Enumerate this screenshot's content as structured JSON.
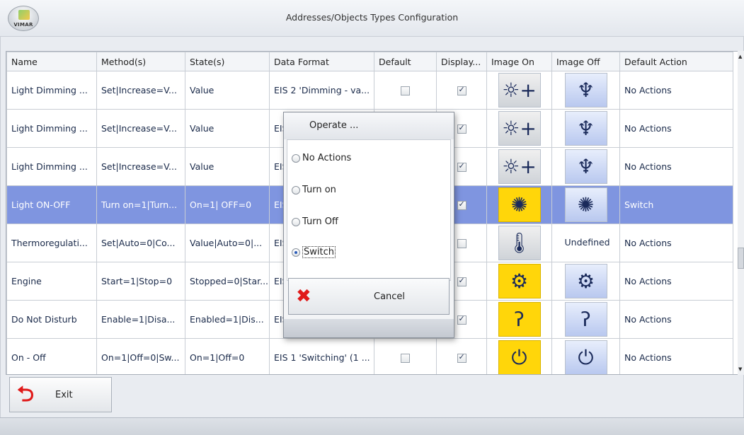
{
  "window": {
    "title": "Addresses/Objects Types Configuration",
    "logo_text": "VIMAR"
  },
  "columns": [
    "Name",
    "Method(s)",
    "State(s)",
    "Data Format",
    "Default",
    "Display...",
    "Image On",
    "Image Off",
    "Default Action"
  ],
  "rows": [
    {
      "name": "Light Dimming ...",
      "methods": "Set|Increase=V...",
      "states": "Value",
      "data_format": "EIS 2 'Dimming - va...",
      "default": false,
      "display": true,
      "image_on": "dimmer-plus-icon",
      "image_off": "dimmer-off-icon",
      "default_action": "No Actions"
    },
    {
      "name": "Light Dimming ...",
      "methods": "Set|Increase=V...",
      "states": "Value",
      "data_format": "EIS",
      "default": false,
      "display": true,
      "image_on": "dimmer-plus-icon",
      "image_off": "dimmer-off-icon",
      "default_action": "No Actions"
    },
    {
      "name": "Light Dimming ...",
      "methods": "Set|Increase=V...",
      "states": "Value",
      "data_format": "EIS",
      "default": false,
      "display": true,
      "image_on": "dimmer-plus-icon",
      "image_off": "dimmer-off-icon",
      "default_action": "No Actions"
    },
    {
      "name": "Light ON-OFF",
      "methods": "Turn on=1|Turn...",
      "states": "On=1| OFF=0",
      "data_format": "EIS",
      "default": false,
      "display": true,
      "image_on": "light-on-icon",
      "image_off": "light-off-icon",
      "default_action": "Switch",
      "selected": true
    },
    {
      "name": "Thermoregulati...",
      "methods": "Set|Auto=0|Co...",
      "states": "Value|Auto=0|...",
      "data_format": "EIS",
      "default": false,
      "display": false,
      "image_on": "thermo-icon",
      "image_off": "Undefined",
      "default_action": "No Actions"
    },
    {
      "name": "Engine",
      "methods": "Start=1|Stop=0",
      "states": "Stopped=0|Star...",
      "data_format": "EIS",
      "default": false,
      "display": true,
      "image_on": "engine-on-icon",
      "image_off": "engine-off-icon",
      "default_action": "No Actions"
    },
    {
      "name": "Do Not Disturb",
      "methods": "Enable=1|Disa...",
      "states": "Enabled=1|Dis...",
      "data_format": "EIS",
      "default": false,
      "display": true,
      "image_on": "dnd-on-icon",
      "image_off": "dnd-off-icon",
      "default_action": "No Actions"
    },
    {
      "name": "On - Off",
      "methods": "On=1|Off=0|Sw...",
      "states": "On=1|Off=0",
      "data_format": "EIS 1 'Switching' (1 ...",
      "default": false,
      "display": true,
      "image_on": "power-on-icon",
      "image_off": "power-off-icon",
      "default_action": "No Actions"
    }
  ],
  "buttons": {
    "exit": "Exit"
  },
  "dialog": {
    "title": "Operate ...",
    "options": [
      {
        "label": "No Actions",
        "checked": false
      },
      {
        "label": "Turn on",
        "checked": false
      },
      {
        "label": "Turn Off",
        "checked": false
      },
      {
        "label": "Switch",
        "checked": true
      }
    ],
    "cancel": "Cancel"
  },
  "colors": {
    "selected_row": "#7f95e0",
    "icon_yellow": "#ffd60a",
    "danger_red": "#e01a1a"
  }
}
